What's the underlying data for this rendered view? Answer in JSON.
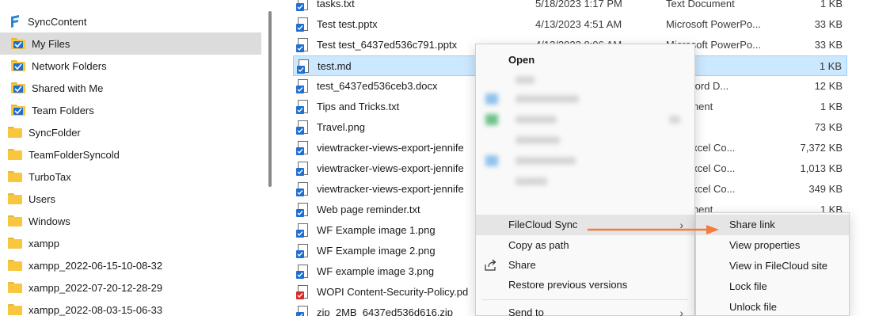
{
  "nav": {
    "items": [
      {
        "label": "SyncContent",
        "kind": "logo"
      },
      {
        "label": "My Files",
        "kind": "sync-folder",
        "selected": true
      },
      {
        "label": "Network Folders",
        "kind": "sync-folder"
      },
      {
        "label": "Shared with Me",
        "kind": "sync-folder"
      },
      {
        "label": "Team Folders",
        "kind": "sync-folder"
      },
      {
        "label": "SyncFolder",
        "kind": "folder"
      },
      {
        "label": "TeamFolderSyncold",
        "kind": "folder"
      },
      {
        "label": "TurboTax",
        "kind": "folder"
      },
      {
        "label": "Users",
        "kind": "folder"
      },
      {
        "label": "Windows",
        "kind": "folder"
      },
      {
        "label": "xampp",
        "kind": "folder"
      },
      {
        "label": "xampp_2022-06-15-10-08-32",
        "kind": "folder"
      },
      {
        "label": "xampp_2022-07-20-12-28-29",
        "kind": "folder"
      },
      {
        "label": "xampp_2022-08-03-15-06-33",
        "kind": "folder"
      }
    ]
  },
  "files": {
    "rows": [
      {
        "name": "tasks.txt",
        "date": "5/18/2023 1:17 PM",
        "type": "Text Document",
        "size": "1 KB",
        "icon": "txt"
      },
      {
        "name": "Test test.pptx",
        "date": "4/13/2023 4:51 AM",
        "type": "Microsoft PowerPo...",
        "size": "33 KB",
        "icon": "pptx"
      },
      {
        "name": "Test test_6437ed536c791.pptx",
        "date": "4/13/2023 8:06 AM",
        "type": "Microsoft PowerPo...",
        "size": "33 KB",
        "icon": "pptx"
      },
      {
        "name": "test.md",
        "date": "",
        "type": "le",
        "size": "1 KB",
        "icon": "md",
        "selected": true
      },
      {
        "name": "test_6437ed536ceb3.docx",
        "date": "",
        "type": "soft Word D...",
        "size": "12 KB",
        "icon": "docx"
      },
      {
        "name": "Tips and Tricks.txt",
        "date": "",
        "type": "Document",
        "size": "1 KB",
        "icon": "txt"
      },
      {
        "name": "Travel.png",
        "date": "",
        "type": "ile",
        "size": "73 KB",
        "icon": "png"
      },
      {
        "name": "viewtracker-views-export-jennife",
        "date": "",
        "type": "soft Excel Co...",
        "size": "7,372 KB",
        "icon": "xlsx"
      },
      {
        "name": "viewtracker-views-export-jennife",
        "date": "",
        "type": "soft Excel Co...",
        "size": "1,013 KB",
        "icon": "xlsx"
      },
      {
        "name": "viewtracker-views-export-jennife",
        "date": "",
        "type": "soft Excel Co...",
        "size": "349 KB",
        "icon": "xlsx"
      },
      {
        "name": "Web page reminder.txt",
        "date": "",
        "type": "Document",
        "size": "1 KB",
        "icon": "txt"
      },
      {
        "name": "WF Example image 1.png",
        "date": "",
        "type": "",
        "size": "",
        "icon": "png"
      },
      {
        "name": "WF Example image 2.png",
        "date": "",
        "type": "",
        "size": "",
        "icon": "png"
      },
      {
        "name": "WF example image 3.png",
        "date": "",
        "type": "",
        "size": "",
        "icon": "png"
      },
      {
        "name": "WOPI Content-Security-Policy.pd",
        "date": "",
        "type": "",
        "size": "",
        "icon": "pdf"
      },
      {
        "name": "zip_2MB_6437ed536d616.zip",
        "date": "",
        "type": "",
        "size": "",
        "icon": "zip"
      }
    ]
  },
  "context_menu": {
    "open": "Open",
    "filecloud_sync": "FileCloud Sync",
    "copy_as_path": "Copy as path",
    "share": "Share",
    "restore_previous": "Restore previous versions",
    "send_to": "Send to",
    "submenu_arrow": "›"
  },
  "submenu": {
    "share_link": "Share link",
    "view_properties": "View properties",
    "view_in_site": "View in FileCloud site",
    "lock_file": "Lock file",
    "unlock_file": "Unlock file"
  },
  "colors": {
    "selection": "#cce8ff",
    "nav_selected": "#dcdcdc",
    "accent_arrow": "#f07d3b",
    "sync_badge": "#1e6fd0",
    "folder": "#f8c63f"
  }
}
